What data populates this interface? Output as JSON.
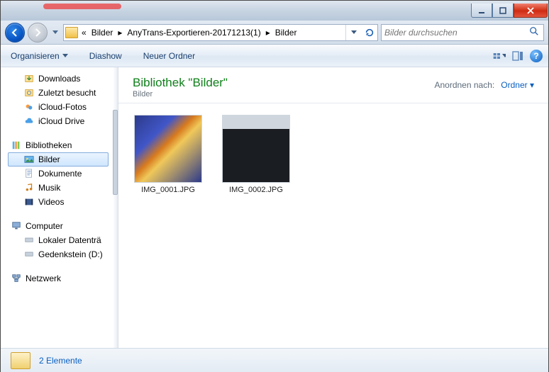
{
  "window": {
    "title": ""
  },
  "breadcrumb": {
    "segs": [
      "Bilder",
      "AnyTrans-Exportieren-20171213(1)",
      "Bilder"
    ]
  },
  "search": {
    "placeholder": "Bilder durchsuchen"
  },
  "toolbar": {
    "organize": "Organisieren",
    "slideshow": "Diashow",
    "newfolder": "Neuer Ordner"
  },
  "sidebar": {
    "quick": [
      {
        "label": "Downloads",
        "icon": "download-icon"
      },
      {
        "label": "Zuletzt besucht",
        "icon": "recent-icon"
      },
      {
        "label": "iCloud-Fotos",
        "icon": "icloud-photos-icon"
      },
      {
        "label": "iCloud Drive",
        "icon": "icloud-drive-icon"
      }
    ],
    "libraries_label": "Bibliotheken",
    "libraries": [
      {
        "label": "Bilder",
        "selected": true
      },
      {
        "label": "Dokumente",
        "selected": false
      },
      {
        "label": "Musik",
        "selected": false
      },
      {
        "label": "Videos",
        "selected": false
      }
    ],
    "computer_label": "Computer",
    "drives": [
      {
        "label": "Lokaler Datenträ"
      },
      {
        "label": "Gedenkstein (D:)"
      }
    ],
    "network_label": "Netzwerk"
  },
  "main": {
    "lib_title": "Bibliothek \"Bilder\"",
    "lib_sub": "Bilder",
    "arrange_label": "Anordnen nach:",
    "arrange_value": "Ordner",
    "items": [
      {
        "name": "IMG_0001.JPG"
      },
      {
        "name": "IMG_0002.JPG"
      }
    ]
  },
  "status": {
    "count_text": "2 Elemente"
  }
}
